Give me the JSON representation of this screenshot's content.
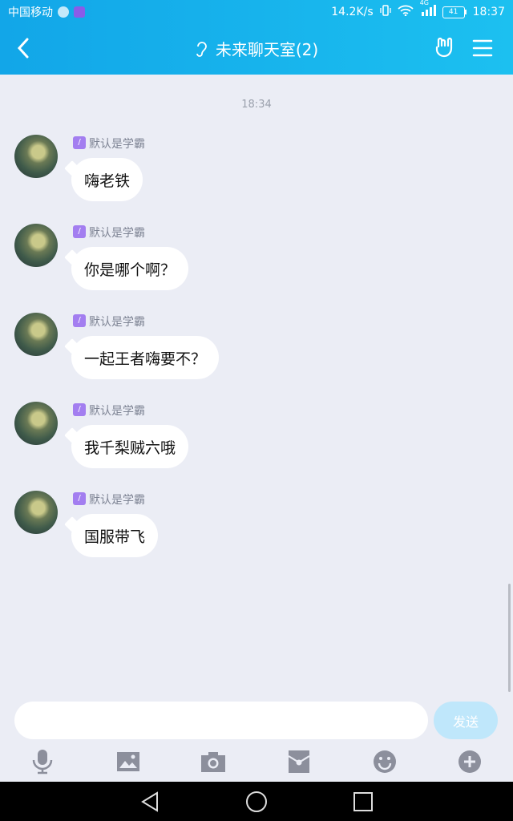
{
  "status_bar": {
    "carrier": "中国移动",
    "network_speed": "14.2K/s",
    "signal_type": "4G",
    "battery": "41",
    "time": "18:37"
  },
  "header": {
    "title": "未来聊天室(2)"
  },
  "chat": {
    "timestamp": "18:34",
    "messages": [
      {
        "tag": "/",
        "nickname": "默认是学霸",
        "text": "嗨老铁"
      },
      {
        "tag": "/",
        "nickname": "默认是学霸",
        "text": "你是哪个啊？"
      },
      {
        "tag": "/",
        "nickname": "默认是学霸",
        "text": "一起王者嗨要不？"
      },
      {
        "tag": "/",
        "nickname": "默认是学霸",
        "text": "我千梨贼六哦"
      },
      {
        "tag": "/",
        "nickname": "默认是学霸",
        "text": "国服带飞"
      }
    ]
  },
  "composer": {
    "placeholder": "",
    "value": "",
    "send_label": "发送"
  },
  "toolbar_icons": [
    "microphone-icon",
    "image-icon",
    "camera-icon",
    "red-packet-icon",
    "emoji-icon",
    "plus-icon"
  ],
  "colors": {
    "header": "#1cb6ee",
    "background": "#ebedf5",
    "tag": "#a37ef0",
    "send_disabled": "#bfe7fb",
    "toolbar_icon": "#8c8f9c"
  }
}
